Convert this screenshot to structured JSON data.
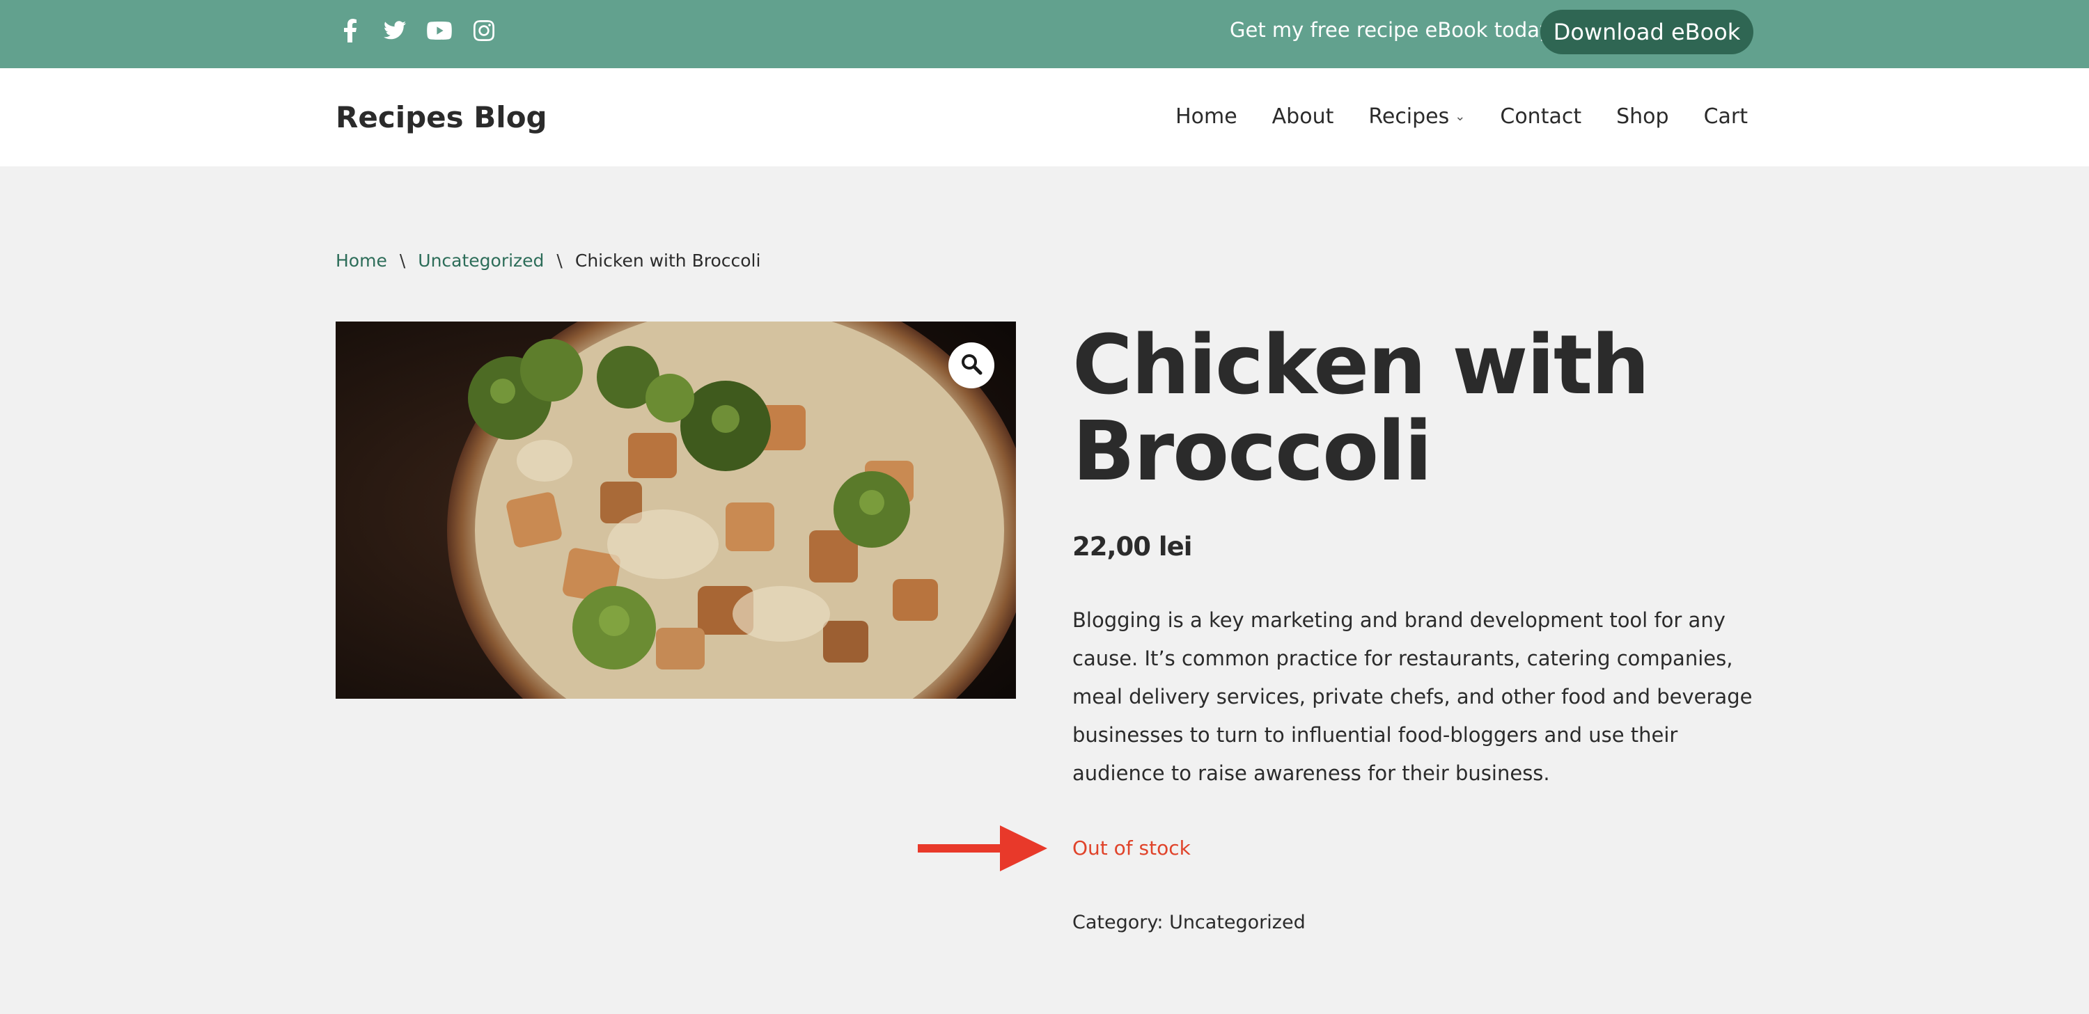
{
  "topbar": {
    "social_icons": [
      "facebook-icon",
      "twitter-icon",
      "youtube-icon",
      "instagram-icon"
    ],
    "promo_text": "Get my free recipe eBook today!",
    "download_button": "Download eBook"
  },
  "header": {
    "brand": "Recipes Blog",
    "nav": [
      {
        "label": "Home"
      },
      {
        "label": "About"
      },
      {
        "label": "Recipes",
        "has_dropdown": true
      },
      {
        "label": "Contact"
      },
      {
        "label": "Shop"
      },
      {
        "label": "Cart"
      }
    ]
  },
  "breadcrumb": {
    "items": [
      "Home",
      "Uncategorized",
      "Chicken with Broccoli"
    ],
    "separator": "\\"
  },
  "product": {
    "title": "Chicken with Broccoli",
    "price": "22,00 lei",
    "description": "Blogging is a key marketing and brand development tool for any cause. It’s common practice for restaurants, catering companies, meal delivery services, private chefs, and other food and beverage businesses to turn to influential food-bloggers and use their audience to raise awareness for their business.",
    "stock_status": "Out of stock",
    "category_label": "Category:",
    "category_value": "Uncategorized",
    "image_icon": "search-icon"
  },
  "colors": {
    "topbar": "#62a18e",
    "button": "#2f6653",
    "link": "#2d6d59",
    "stock": "#e0432a",
    "annotation_arrow": "#e8392a",
    "background": "#f1f1f1"
  }
}
